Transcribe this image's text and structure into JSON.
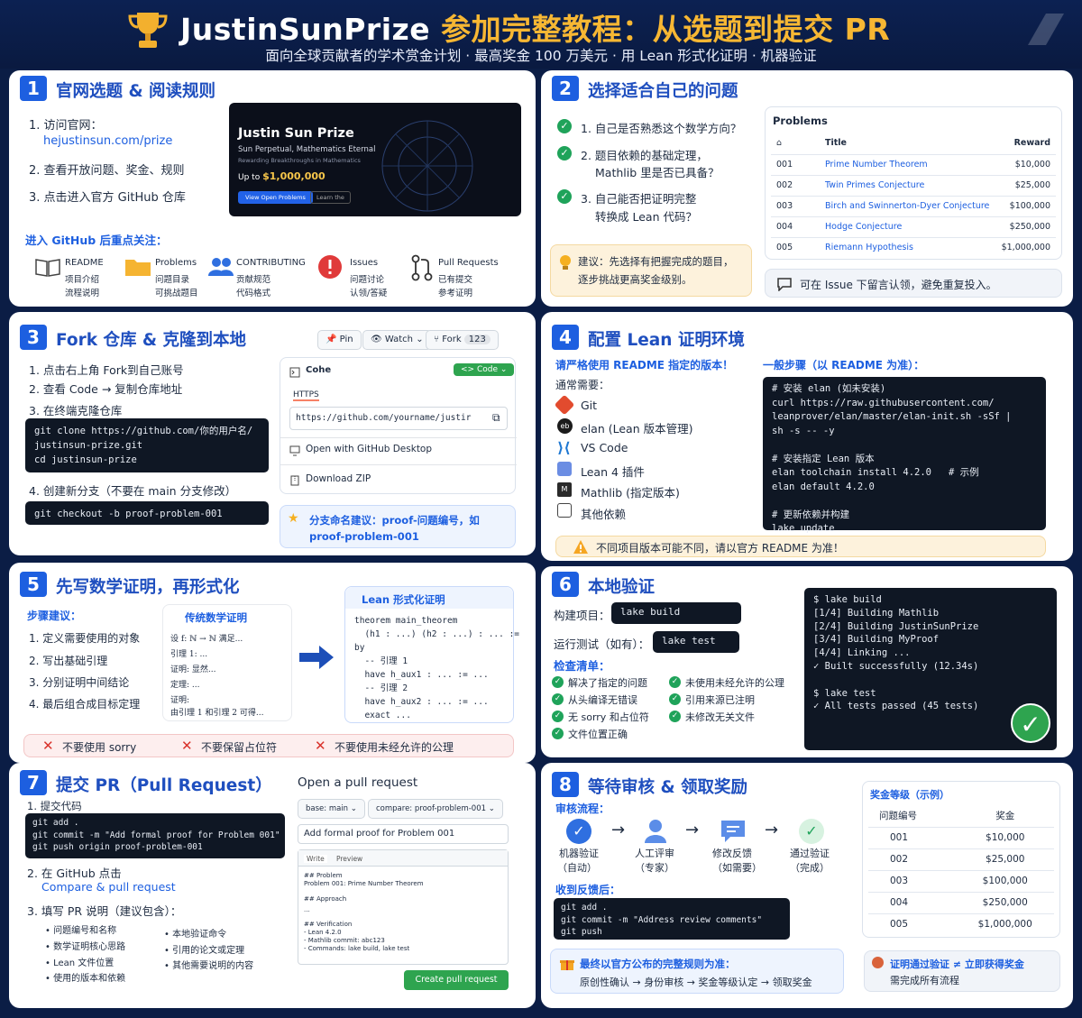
{
  "header": {
    "title": "JustinSunPrize",
    "title_suffix": "参加完整教程：从选题到提交 PR",
    "subtitle": "面向全球贡献者的学术赏金计划 · 最高奖金 100 万美元 · 用 Lean 形式化证明 · 机器验证"
  },
  "s1": {
    "num": "1",
    "title": "官网选题 & 阅读规则",
    "steps": [
      "1. 访问官网：",
      "hejustinsun.com/prize",
      "2. 查看开放问题、奖金、规则",
      "3. 点击进入官方 GitHub 仓库"
    ],
    "site": {
      "title": "Justin Sun Prize",
      "line1": "Sun Perpetual, Mathematics Eternal",
      "line2": "Rewarding Breakthroughs in Mathematics",
      "upto": "Up to",
      "amount": "$1,000,000",
      "btn1": "View Open Problems",
      "btn2": "Learn the"
    },
    "focus_title": "进入 GitHub 后重点关注：",
    "focus": [
      {
        "name": "README",
        "d1": "项目介绍",
        "d2": "流程说明"
      },
      {
        "name": "Problems",
        "d1": "问题目录",
        "d2": "可挑战题目"
      },
      {
        "name": "CONTRIBUTING",
        "d1": "贡献规范",
        "d2": "代码格式"
      },
      {
        "name": "Issues",
        "d1": "问题讨论",
        "d2": "认领/答疑"
      },
      {
        "name": "Pull Requests",
        "d1": "已有提交",
        "d2": "参考证明"
      }
    ]
  },
  "s2": {
    "num": "2",
    "title": "选择适合自己的问题",
    "q": [
      "1. 自己是否熟悉这个数学方向？",
      "2. 题目依赖的基础定理，",
      "Mathlib 里是否已具备？",
      "3. 自己能否把证明完整",
      "转换成 Lean 代码？"
    ],
    "tip": [
      "建议：先选择有把握完成的题目，",
      "逐步挑战更高奖金级别。"
    ],
    "table": {
      "title": "Problems",
      "headers": [
        "Title",
        "Reward"
      ],
      "rows": [
        [
          "001",
          "Prime Number Theorem",
          "$10,000"
        ],
        [
          "002",
          "Twin Primes Conjecture",
          "$25,000"
        ],
        [
          "003",
          "Birch and Swinnerton-Dyer Conjecture",
          "$100,000"
        ],
        [
          "004",
          "Hodge Conjecture",
          "$250,000"
        ],
        [
          "005",
          "Riemann Hypothesis",
          "$1,000,000"
        ]
      ]
    },
    "issue_note": "可在 Issue 下留言认领，避免重复投入。"
  },
  "s3": {
    "num": "3",
    "title": "Fork 仓库 & 克隆到本地",
    "steps": [
      "1. 点击右上角 Fork到自己账号",
      "2. 查看 Code → 复制仓库地址",
      "3. 在终端克隆仓库",
      "4. 创建新分支（不要在 main 分支修改）"
    ],
    "code1": "git clone https://github.com/你的用户名/\njustinsun-prize.git\ncd justinsun-prize",
    "code2": "git checkout -b proof-problem-001",
    "gh": {
      "pin": "Pin",
      "watch": "Watch",
      "fork": "Fork",
      "fork_count": "123",
      "clone": "Cohe",
      "code_btn": "Code",
      "https": "HTTPS",
      "url": "https://github.com/yourname/justir",
      "desktop": "Open with GitHub Desktop",
      "zip": "Download ZIP"
    },
    "tip": [
      "分支命名建议：proof-问题编号，如",
      "proof-problem-001"
    ]
  },
  "s4": {
    "num": "4",
    "title": "配置 Lean 证明环境",
    "note": "请严格使用 README 指定的版本！",
    "need": "通常需要：",
    "tools": [
      "Git",
      "elan (Lean 版本管理)",
      "VS Code",
      "Lean 4 插件",
      "Mathlib (指定版本)",
      "其他依赖"
    ],
    "gen": "一般步骤（以 README 为准）：",
    "code": "# 安装 elan (如未安装)\ncurl https://raw.githubusercontent.com/\nleanprover/elan/master/elan-init.sh -sSf |\nsh -s -- -y\n\n# 安装指定 Lean 版本\nelan toolchain install 4.2.0   # 示例\nelan default 4.2.0\n\n# 更新依赖并构建\nlake update\nlake build",
    "warn": "不同项目版本可能不同，请以官方 README 为准！"
  },
  "s5": {
    "num": "5",
    "title": "先写数学证明，再形式化",
    "adv": "步骤建议：",
    "steps": [
      "1. 定义需要使用的对象",
      "2. 写出基础引理",
      "3. 分别证明中间结论",
      "4. 最后组合成目标定理"
    ],
    "math_title": "传统数学证明",
    "math": [
      "设 f: ℕ → ℕ 满足...",
      "引理 1: ...",
      "证明: 显然...",
      "定理: ...",
      "证明:",
      "由引理 1 和引理 2 可得..."
    ],
    "lean_title": "Lean 形式化证明",
    "lean": "theorem main_theorem\n  (h1 : ...) (h2 : ...) : ... :=\nby\n  -- 引理 1\n  have h_aux1 : ... := ...\n  -- 引理 2\n  have h_aux2 : ... := ...\n  exact ...",
    "dont": [
      "不要使用 sorry",
      "不要保留占位符",
      "不要使用未经允许的公理"
    ]
  },
  "s6": {
    "num": "6",
    "title": "本地验证",
    "build_label": "构建项目：",
    "build": "lake build",
    "test_label": "运行测试（如有）：",
    "test": "lake test",
    "list_title": "检查清单：",
    "list_left": [
      "解决了指定的问题",
      "从头编译无错误",
      "无 sorry 和占位符",
      "文件位置正确"
    ],
    "list_right": [
      "未使用未经允许的公理",
      "引用来源已注明",
      "未修改无关文件"
    ],
    "term": "$ lake build\n[1/4] Building Mathlib\n[2/4] Building JustinSunPrize\n[3/4] Building MyProof\n[4/4] Linking ...\n✓ Built successfully (12.34s)\n\n$ lake test\n✓ All tests passed (45 tests)"
  },
  "s7": {
    "num": "7",
    "title": "提交 PR（Pull Request）",
    "step1": "1. 提交代码",
    "code": "git add .\ngit commit -m \"Add formal proof for Problem 001\"\ngit push origin proof-problem-001",
    "step2a": "2. 在 GitHub 点击",
    "step2b": "Compare & pull request",
    "step3": "3. 填写 PR 说明（建议包含）：",
    "bul_left": [
      "问题编号和名称",
      "数学证明核心思路",
      "Lean 文件位置",
      "使用的版本和依赖"
    ],
    "bul_right": [
      "本地验证命令",
      "引用的论文或定理",
      "其他需要说明的内容"
    ],
    "pr": {
      "title": "Open a pull request",
      "base": "base: main",
      "compare": "compare: proof-problem-001",
      "pr_title": "Add formal proof for Problem 001",
      "write": "Write",
      "preview": "Preview",
      "body": [
        "## Problem",
        "Problem 001:  Prime Number Theorem",
        "",
        "## Approach",
        "...",
        "",
        "## Verification",
        "- Lean 4.2.0",
        "- Mathlib commit:  abc123",
        "- Commands:  lake build,  lake test"
      ],
      "btn": "Create pull request"
    }
  },
  "s8": {
    "num": "8",
    "title": "等待审核 & 领取奖励",
    "flow_title": "审核流程：",
    "flow": [
      {
        "a": "机器验证",
        "b": "（自动）"
      },
      {
        "a": "人工评审",
        "b": "（专家）"
      },
      {
        "a": "修改反馈",
        "b": "（如需要）"
      },
      {
        "a": "通过验证",
        "b": "（完成）"
      }
    ],
    "fb": "收到反馈后：",
    "code": "git add .\ngit commit -m \"Address review comments\"\ngit push",
    "tip1": "最终以官方公布的完整规则为准：",
    "tip2": "原创性确认 → 身份审核 → 奖金等级认定 → 领取奖金",
    "prize_title": "奖金等级（示例）",
    "prize_headers": [
      "问题编号",
      "奖金"
    ],
    "prizes": [
      [
        "001",
        "$10,000"
      ],
      [
        "002",
        "$25,000"
      ],
      [
        "003",
        "$100,000"
      ],
      [
        "004",
        "$250,000"
      ],
      [
        "005",
        "$1,000,000"
      ]
    ],
    "note1": "证明通过验证 ≠ 立即获得奖金",
    "note2": "需完成所有流程"
  },
  "colors": {
    "navy": "#0b1d45",
    "blue": "#1d5fe0",
    "green": "#1fa35a",
    "red": "#d9322b",
    "gold": "#f7b733"
  }
}
